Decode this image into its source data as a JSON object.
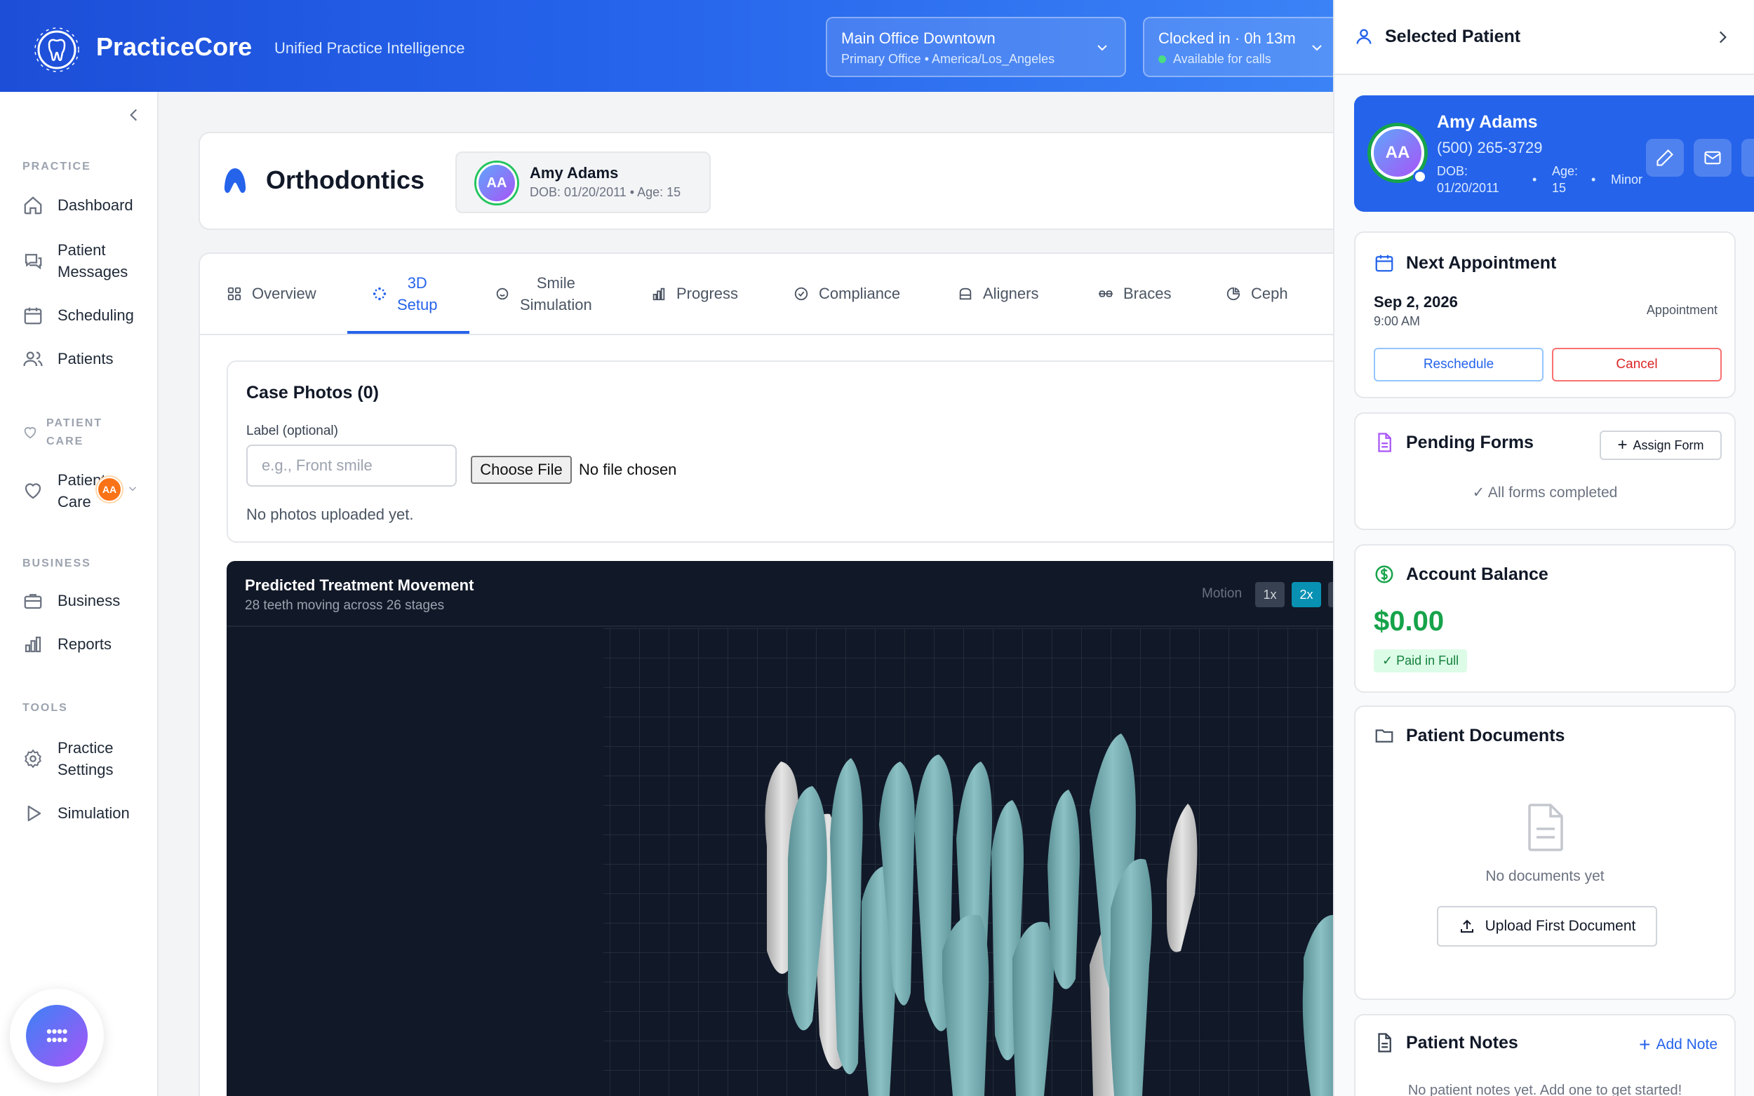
{
  "header": {
    "brand": "PracticeCore",
    "tagline": "Unified Practice Intelligence",
    "location": {
      "name": "Main Office Downtown",
      "detail": "Primary Office • America/Los_Angeles"
    },
    "clock": {
      "status": "Clocked in · 0h 13m",
      "availability": "Available for calls"
    }
  },
  "sidebar": {
    "sections": {
      "practice": "PRACTICE",
      "patient_care_line1": "PATIENT",
      "patient_care_line2": "CARE",
      "business": "BUSINESS",
      "tools": "TOOLS"
    },
    "items": {
      "dashboard": "Dashboard",
      "messages_line1": "Patient",
      "messages_line2": "Messages",
      "scheduling": "Scheduling",
      "patients": "Patients",
      "patient_care_line1": "Patient",
      "patient_care_line2": "Care",
      "patient_care_badge": "AA",
      "business": "Business",
      "reports": "Reports",
      "settings_line1": "Practice",
      "settings_line2": "Settings",
      "simulation": "Simulation"
    }
  },
  "module": {
    "title": "Orthodontics",
    "patient": {
      "initials": "AA",
      "name": "Amy Adams",
      "meta": "DOB: 01/20/2011 • Age: 15"
    }
  },
  "tabs": [
    {
      "label": "Overview",
      "icon": "grid-icon"
    },
    {
      "label_line1": "3D",
      "label_line2": "Setup",
      "icon": "dots-icon",
      "active": true
    },
    {
      "label_line1": "Smile",
      "label_line2": "Simulation",
      "icon": "smile-icon"
    },
    {
      "label": "Progress",
      "icon": "bar-chart-icon"
    },
    {
      "label": "Compliance",
      "icon": "check-circle-icon"
    },
    {
      "label": "Aligners",
      "icon": "aligner-icon"
    },
    {
      "label": "Braces",
      "icon": "braces-icon"
    },
    {
      "label": "Ceph",
      "icon": "pie-icon"
    }
  ],
  "case_photos": {
    "title": "Case Photos (0)",
    "label_caption": "Label (optional)",
    "label_placeholder": "e.g., Front smile",
    "file_button": "Choose File",
    "file_status": "No file chosen",
    "empty": "No photos uploaded yet."
  },
  "viewer": {
    "title": "Predicted Treatment Movement",
    "subtitle": "28 teeth moving across 26 stages",
    "motion_label": "Motion",
    "speed_options": [
      "1x",
      "2x"
    ],
    "selected_speed": "2x"
  },
  "panel": {
    "title": "Selected Patient",
    "patient": {
      "initials": "AA",
      "name": "Amy Adams",
      "phone": "(500) 265-3729",
      "dob_label": "DOB:",
      "dob": "01/20/2011",
      "age_label": "Age:",
      "age": "15",
      "status": "Minor"
    },
    "next_appointment": {
      "title": "Next Appointment",
      "date": "Sep 2, 2026",
      "time": "9:00 AM",
      "type": "Appointment",
      "reschedule": "Reschedule",
      "cancel": "Cancel"
    },
    "pending_forms": {
      "title": "Pending Forms",
      "assign": "Assign Form",
      "status": "✓ All forms completed"
    },
    "account_balance": {
      "title": "Account Balance",
      "amount": "$0.00",
      "badge": "✓ Paid in Full"
    },
    "documents": {
      "title": "Patient Documents",
      "empty": "No documents yet",
      "upload": "Upload First Document"
    },
    "notes": {
      "title": "Patient Notes",
      "add": "Add Note",
      "empty": "No patient notes yet. Add one to get started!"
    }
  },
  "colors": {
    "primary": "#2563eb",
    "header_gradient_start": "#1d4ed8",
    "success": "#16a34a",
    "danger": "#dc2626",
    "tooth_teal": "#7fb3b7",
    "tooth_white": "#d4d4d4",
    "viewer_bg": "#111827"
  }
}
